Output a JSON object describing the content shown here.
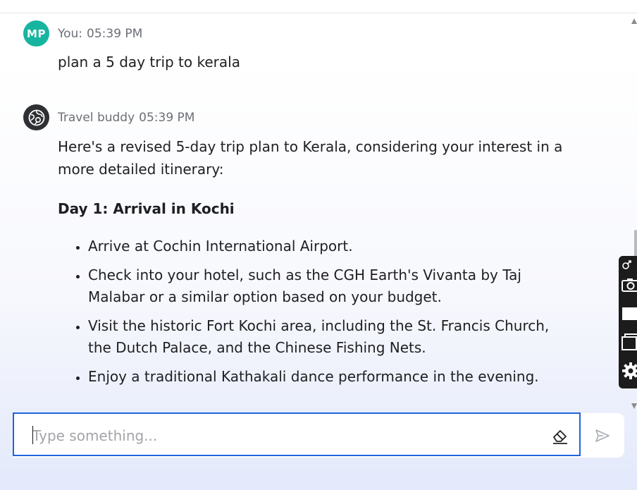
{
  "conversation": {
    "messages": [
      {
        "avatar": "MP",
        "author": "You:",
        "time": "05:39 PM",
        "text": "plan a 5 day trip to kerala"
      },
      {
        "avatar_icon": "globe-icon",
        "author": "Travel buddy",
        "time": "05:39 PM",
        "intro": "Here's a revised 5-day trip plan to Kerala, considering your interest in a more detailed itinerary:",
        "day_heading": "Day 1: Arrival in Kochi",
        "bullets": [
          "Arrive at Cochin International Airport.",
          "Check into your hotel, such as the CGH Earth's Vivanta by Taj Malabar or a similar option based on your budget.",
          "Visit the historic Fort Kochi area, including the St. Francis Church, the Dutch Palace, and the Chinese Fishing Nets.",
          "Enjoy a traditional Kathakali dance performance in the evening."
        ]
      }
    ]
  },
  "composer": {
    "placeholder": "Type something...",
    "value": "",
    "clear_icon": "eraser-icon",
    "send_icon": "send-icon"
  },
  "side_toolbar": {
    "icons": [
      "link-icon",
      "camera-icon",
      "rectangle-icon",
      "window-icon",
      "gear-icon"
    ]
  },
  "colors": {
    "user_avatar": "#17b59f",
    "bot_avatar": "#2f3033",
    "composer_border": "#1f63e0"
  }
}
